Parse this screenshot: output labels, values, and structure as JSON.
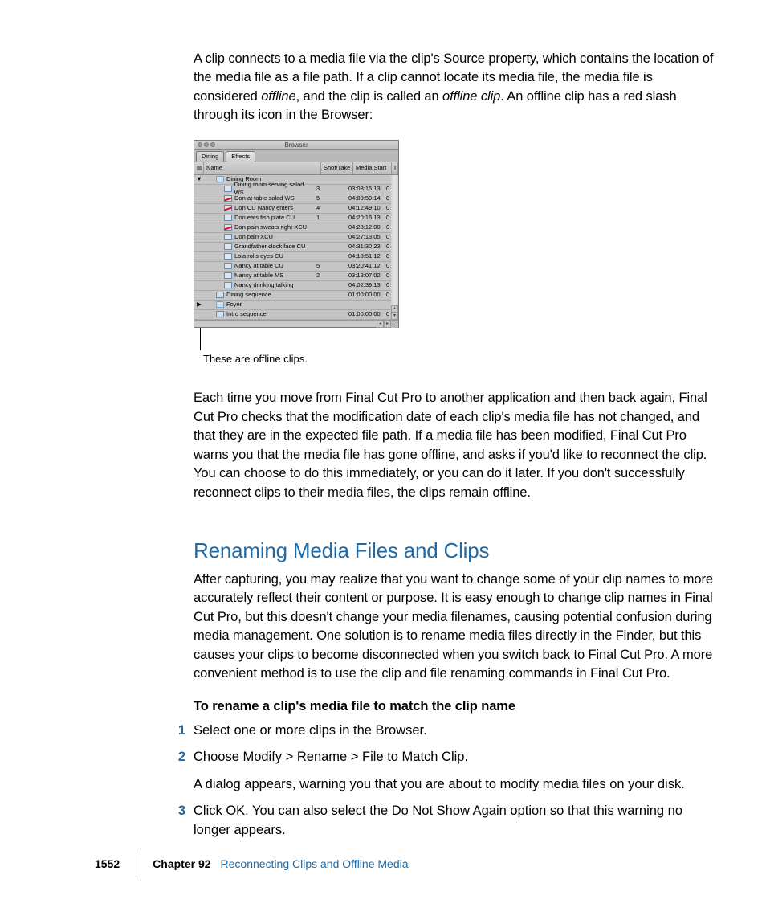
{
  "para1_a": "A clip connects to a media file via the clip's Source property, which contains the location of the media file as a file path. If a clip cannot locate its media file, the media file is considered ",
  "para1_offline": "offline",
  "para1_b": ", and the clip is called an ",
  "para1_offlineclip": "offline clip",
  "para1_c": ". An offline clip has a red slash through its icon in the Browser:",
  "browser": {
    "title": "Browser",
    "tabs": [
      "Dining",
      "Effects"
    ],
    "headers": {
      "name": "Name",
      "shot": "Shot/Take",
      "media": "Media Start"
    },
    "rows": [
      {
        "kind": "bin",
        "indent": 0,
        "disc": "▼",
        "name": "Dining Room",
        "shot": "",
        "media": "",
        "last": "",
        "offline": false
      },
      {
        "kind": "clip",
        "indent": 1,
        "name": "Dining room serving salad WS",
        "shot": "3",
        "media": "03:08:16:13",
        "last": "0",
        "offline": false
      },
      {
        "kind": "clip",
        "indent": 1,
        "name": "Don at table salad WS",
        "shot": "5",
        "media": "04:09:59:14",
        "last": "0",
        "offline": true
      },
      {
        "kind": "clip",
        "indent": 1,
        "name": "Don CU Nancy enters",
        "shot": "4",
        "media": "04:12:49:10",
        "last": "0",
        "offline": true
      },
      {
        "kind": "clip",
        "indent": 1,
        "name": "Don eats fish plate CU",
        "shot": "1",
        "media": "04:20:16:13",
        "last": "0",
        "offline": false
      },
      {
        "kind": "clip",
        "indent": 1,
        "name": "Don pain sweats right XCU",
        "shot": "",
        "media": "04:28:12:00",
        "last": "0",
        "offline": true
      },
      {
        "kind": "clip",
        "indent": 1,
        "name": "Don pain XCU",
        "shot": "",
        "media": "04:27:13:05",
        "last": "0",
        "offline": false
      },
      {
        "kind": "clip",
        "indent": 1,
        "name": "Grandfather clock face CU",
        "shot": "",
        "media": "04:31:30:23",
        "last": "0",
        "offline": false
      },
      {
        "kind": "clip",
        "indent": 1,
        "name": "Lola rolls eyes CU",
        "shot": "",
        "media": "04:18:51:12",
        "last": "0",
        "offline": false
      },
      {
        "kind": "clip",
        "indent": 1,
        "name": "Nancy at table CU",
        "shot": "5",
        "media": "03:20:41:12",
        "last": "0",
        "offline": false
      },
      {
        "kind": "clip",
        "indent": 1,
        "name": "Nancy at table MS",
        "shot": "2",
        "media": "03:13:07:02",
        "last": "0",
        "offline": false
      },
      {
        "kind": "clip",
        "indent": 1,
        "name": "Nancy drinking talking",
        "shot": "",
        "media": "04:02:39:13",
        "last": "0",
        "offline": false
      },
      {
        "kind": "seq",
        "indent": 0,
        "name": "Dining sequence",
        "shot": "",
        "media": "01:00:00:00",
        "last": "0",
        "offline": false
      },
      {
        "kind": "bin",
        "indent": 0,
        "disc": "▶",
        "name": "Foyer",
        "shot": "",
        "media": "",
        "last": "",
        "offline": false
      },
      {
        "kind": "seq",
        "indent": 0,
        "name": "Intro sequence",
        "shot": "",
        "media": "01:00:00:00",
        "last": "0",
        "offline": false
      }
    ]
  },
  "caption": "These are offline clips.",
  "para2": "Each time you move from Final Cut Pro to another application and then back again, Final Cut Pro checks that the modification date of each clip's media file has not changed, and that they are in the expected file path. If a media file has been modified, Final Cut Pro warns you that the media file has gone offline, and asks if you'd like to reconnect the clip. You can choose to do this immediately, or you can do it later. If you don't successfully reconnect clips to their media files, the clips remain offline.",
  "section_heading": "Renaming Media Files and Clips",
  "para3": "After capturing, you may realize that you want to change some of your clip names to more accurately reflect their content or purpose. It is easy enough to change clip names in Final Cut Pro, but this doesn't change your media filenames, causing potential confusion during media management. One solution is to rename media files directly in the Finder, but this causes your clips to become disconnected when you switch back to Final Cut Pro. A more convenient method is to use the clip and file renaming commands in Final Cut Pro.",
  "task_heading": "To rename a clip's media file to match the clip name",
  "steps": [
    {
      "num": "1",
      "body": "Select one or more clips in the Browser."
    },
    {
      "num": "2",
      "body": "Choose Modify > Rename > File to Match Clip.",
      "sub": "A dialog appears, warning you that you are about to modify media files on your disk."
    },
    {
      "num": "3",
      "body": "Click OK. You can also select the Do Not Show Again option so that this warning no longer appears."
    }
  ],
  "footer": {
    "page": "1552",
    "chapter_label": "Chapter 92",
    "chapter_title": "Reconnecting Clips and Offline Media"
  }
}
